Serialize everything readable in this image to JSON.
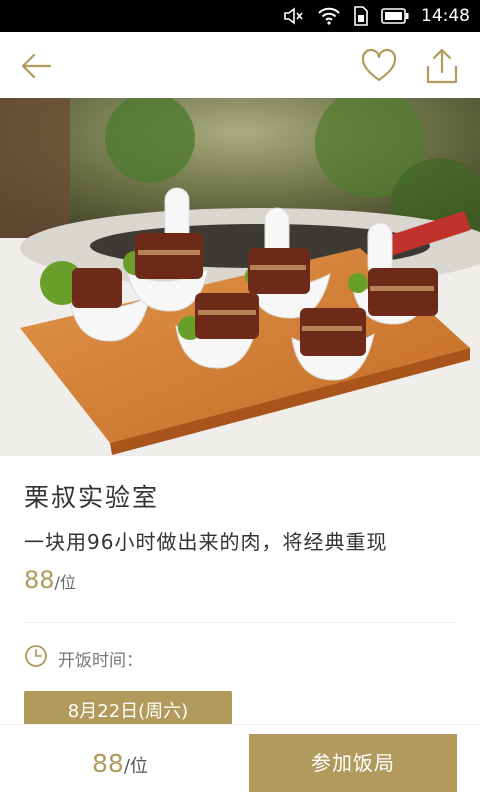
{
  "status_bar": {
    "time": "14:48",
    "icons": [
      "mute-icon",
      "wifi-icon",
      "sim-icon",
      "battery-icon"
    ]
  },
  "header": {
    "back_icon": "back-arrow-icon",
    "favorite_icon": "heart-icon",
    "share_icon": "share-icon"
  },
  "event": {
    "title": "栗叔实验室",
    "subtitle": "一块用96小时做出来的肉，将经典重现",
    "price": "88",
    "price_unit": "/位",
    "time_label": "开饭时间：",
    "date": "8月22日(周六)"
  },
  "bottom_bar": {
    "price": "88",
    "price_unit": "/位",
    "join_label": "参加饭局"
  },
  "colors": {
    "accent": "#b19a5c",
    "text": "#333333",
    "muted": "#777777",
    "statusbar": "#000000"
  }
}
